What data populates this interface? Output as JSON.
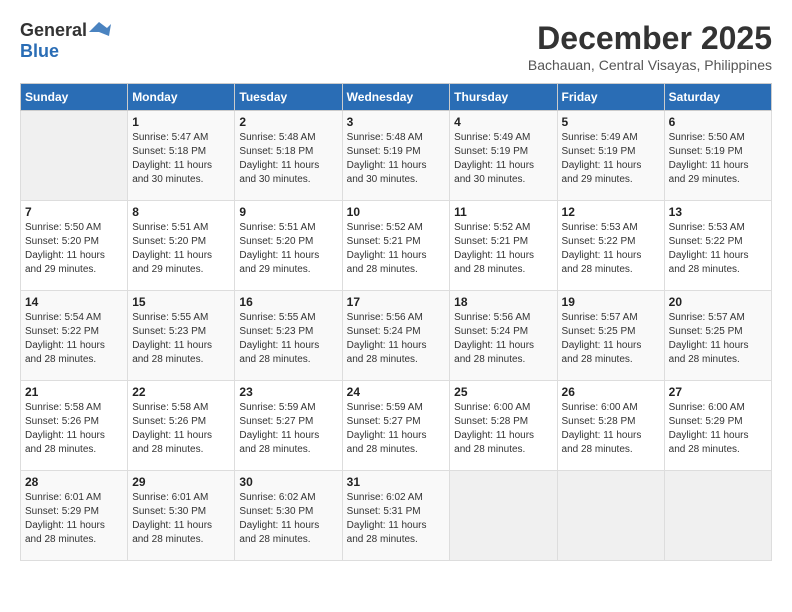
{
  "header": {
    "logo_general": "General",
    "logo_blue": "Blue",
    "month_title": "December 2025",
    "location": "Bachauan, Central Visayas, Philippines"
  },
  "weekdays": [
    "Sunday",
    "Monday",
    "Tuesday",
    "Wednesday",
    "Thursday",
    "Friday",
    "Saturday"
  ],
  "weeks": [
    [
      {
        "day": "",
        "sunrise": "",
        "sunset": "",
        "daylight": ""
      },
      {
        "day": "1",
        "sunrise": "Sunrise: 5:47 AM",
        "sunset": "Sunset: 5:18 PM",
        "daylight": "Daylight: 11 hours and 30 minutes."
      },
      {
        "day": "2",
        "sunrise": "Sunrise: 5:48 AM",
        "sunset": "Sunset: 5:18 PM",
        "daylight": "Daylight: 11 hours and 30 minutes."
      },
      {
        "day": "3",
        "sunrise": "Sunrise: 5:48 AM",
        "sunset": "Sunset: 5:19 PM",
        "daylight": "Daylight: 11 hours and 30 minutes."
      },
      {
        "day": "4",
        "sunrise": "Sunrise: 5:49 AM",
        "sunset": "Sunset: 5:19 PM",
        "daylight": "Daylight: 11 hours and 30 minutes."
      },
      {
        "day": "5",
        "sunrise": "Sunrise: 5:49 AM",
        "sunset": "Sunset: 5:19 PM",
        "daylight": "Daylight: 11 hours and 29 minutes."
      },
      {
        "day": "6",
        "sunrise": "Sunrise: 5:50 AM",
        "sunset": "Sunset: 5:19 PM",
        "daylight": "Daylight: 11 hours and 29 minutes."
      }
    ],
    [
      {
        "day": "7",
        "sunrise": "Sunrise: 5:50 AM",
        "sunset": "Sunset: 5:20 PM",
        "daylight": "Daylight: 11 hours and 29 minutes."
      },
      {
        "day": "8",
        "sunrise": "Sunrise: 5:51 AM",
        "sunset": "Sunset: 5:20 PM",
        "daylight": "Daylight: 11 hours and 29 minutes."
      },
      {
        "day": "9",
        "sunrise": "Sunrise: 5:51 AM",
        "sunset": "Sunset: 5:20 PM",
        "daylight": "Daylight: 11 hours and 29 minutes."
      },
      {
        "day": "10",
        "sunrise": "Sunrise: 5:52 AM",
        "sunset": "Sunset: 5:21 PM",
        "daylight": "Daylight: 11 hours and 28 minutes."
      },
      {
        "day": "11",
        "sunrise": "Sunrise: 5:52 AM",
        "sunset": "Sunset: 5:21 PM",
        "daylight": "Daylight: 11 hours and 28 minutes."
      },
      {
        "day": "12",
        "sunrise": "Sunrise: 5:53 AM",
        "sunset": "Sunset: 5:22 PM",
        "daylight": "Daylight: 11 hours and 28 minutes."
      },
      {
        "day": "13",
        "sunrise": "Sunrise: 5:53 AM",
        "sunset": "Sunset: 5:22 PM",
        "daylight": "Daylight: 11 hours and 28 minutes."
      }
    ],
    [
      {
        "day": "14",
        "sunrise": "Sunrise: 5:54 AM",
        "sunset": "Sunset: 5:22 PM",
        "daylight": "Daylight: 11 hours and 28 minutes."
      },
      {
        "day": "15",
        "sunrise": "Sunrise: 5:55 AM",
        "sunset": "Sunset: 5:23 PM",
        "daylight": "Daylight: 11 hours and 28 minutes."
      },
      {
        "day": "16",
        "sunrise": "Sunrise: 5:55 AM",
        "sunset": "Sunset: 5:23 PM",
        "daylight": "Daylight: 11 hours and 28 minutes."
      },
      {
        "day": "17",
        "sunrise": "Sunrise: 5:56 AM",
        "sunset": "Sunset: 5:24 PM",
        "daylight": "Daylight: 11 hours and 28 minutes."
      },
      {
        "day": "18",
        "sunrise": "Sunrise: 5:56 AM",
        "sunset": "Sunset: 5:24 PM",
        "daylight": "Daylight: 11 hours and 28 minutes."
      },
      {
        "day": "19",
        "sunrise": "Sunrise: 5:57 AM",
        "sunset": "Sunset: 5:25 PM",
        "daylight": "Daylight: 11 hours and 28 minutes."
      },
      {
        "day": "20",
        "sunrise": "Sunrise: 5:57 AM",
        "sunset": "Sunset: 5:25 PM",
        "daylight": "Daylight: 11 hours and 28 minutes."
      }
    ],
    [
      {
        "day": "21",
        "sunrise": "Sunrise: 5:58 AM",
        "sunset": "Sunset: 5:26 PM",
        "daylight": "Daylight: 11 hours and 28 minutes."
      },
      {
        "day": "22",
        "sunrise": "Sunrise: 5:58 AM",
        "sunset": "Sunset: 5:26 PM",
        "daylight": "Daylight: 11 hours and 28 minutes."
      },
      {
        "day": "23",
        "sunrise": "Sunrise: 5:59 AM",
        "sunset": "Sunset: 5:27 PM",
        "daylight": "Daylight: 11 hours and 28 minutes."
      },
      {
        "day": "24",
        "sunrise": "Sunrise: 5:59 AM",
        "sunset": "Sunset: 5:27 PM",
        "daylight": "Daylight: 11 hours and 28 minutes."
      },
      {
        "day": "25",
        "sunrise": "Sunrise: 6:00 AM",
        "sunset": "Sunset: 5:28 PM",
        "daylight": "Daylight: 11 hours and 28 minutes."
      },
      {
        "day": "26",
        "sunrise": "Sunrise: 6:00 AM",
        "sunset": "Sunset: 5:28 PM",
        "daylight": "Daylight: 11 hours and 28 minutes."
      },
      {
        "day": "27",
        "sunrise": "Sunrise: 6:00 AM",
        "sunset": "Sunset: 5:29 PM",
        "daylight": "Daylight: 11 hours and 28 minutes."
      }
    ],
    [
      {
        "day": "28",
        "sunrise": "Sunrise: 6:01 AM",
        "sunset": "Sunset: 5:29 PM",
        "daylight": "Daylight: 11 hours and 28 minutes."
      },
      {
        "day": "29",
        "sunrise": "Sunrise: 6:01 AM",
        "sunset": "Sunset: 5:30 PM",
        "daylight": "Daylight: 11 hours and 28 minutes."
      },
      {
        "day": "30",
        "sunrise": "Sunrise: 6:02 AM",
        "sunset": "Sunset: 5:30 PM",
        "daylight": "Daylight: 11 hours and 28 minutes."
      },
      {
        "day": "31",
        "sunrise": "Sunrise: 6:02 AM",
        "sunset": "Sunset: 5:31 PM",
        "daylight": "Daylight: 11 hours and 28 minutes."
      },
      {
        "day": "",
        "sunrise": "",
        "sunset": "",
        "daylight": ""
      },
      {
        "day": "",
        "sunrise": "",
        "sunset": "",
        "daylight": ""
      },
      {
        "day": "",
        "sunrise": "",
        "sunset": "",
        "daylight": ""
      }
    ]
  ]
}
